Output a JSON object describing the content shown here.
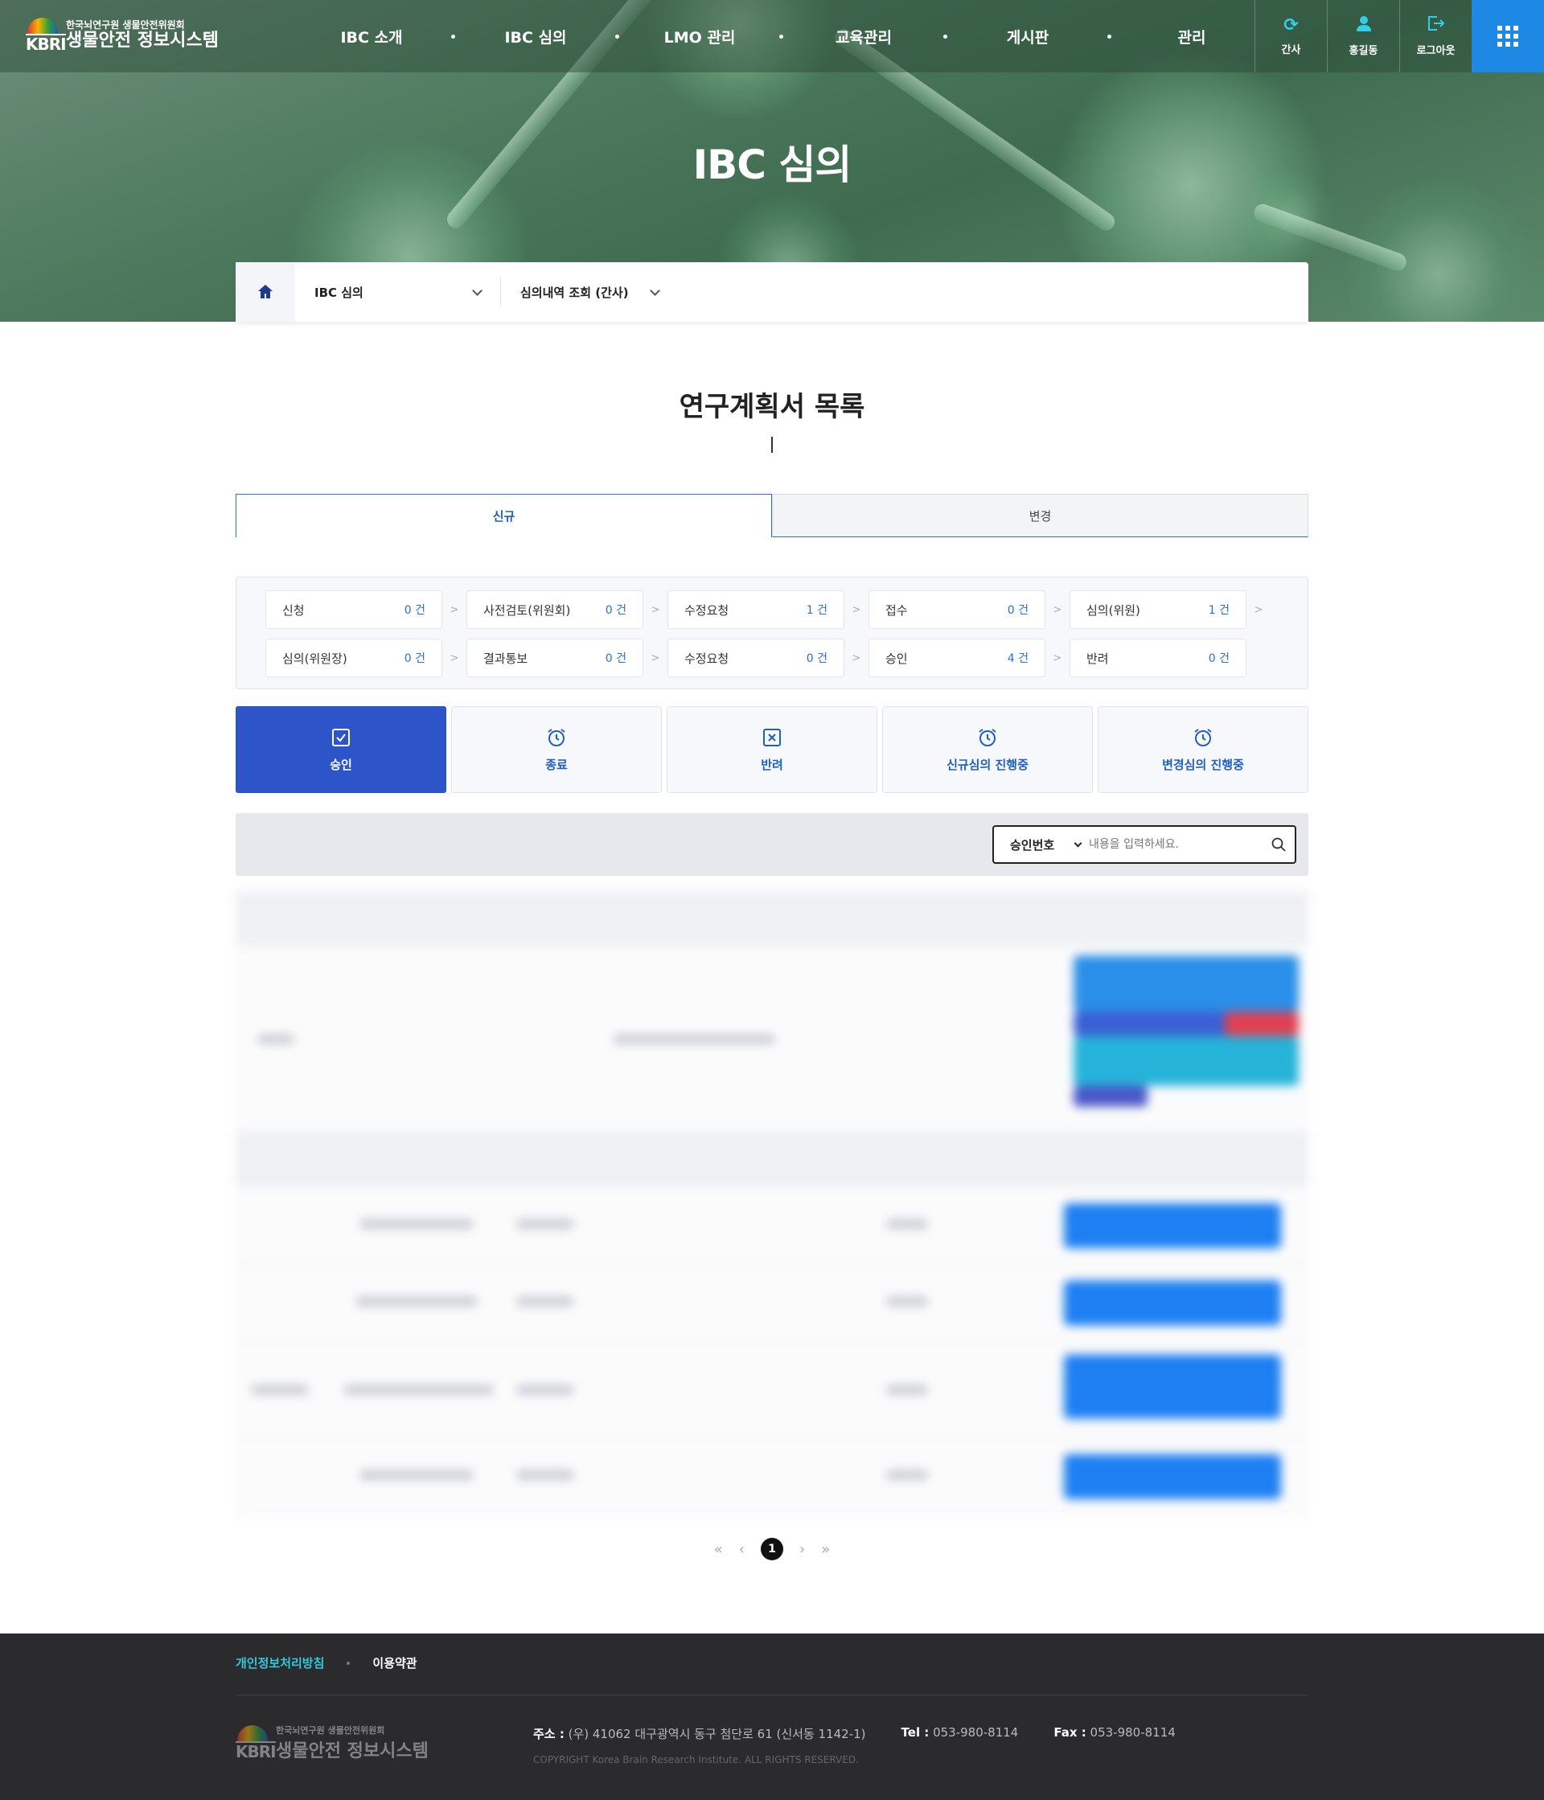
{
  "header": {
    "logo_sub": "한국뇌연구원 생물안전위원회",
    "logo_main": "생물안전 정보시스템",
    "logo_mark": "KBRI",
    "nav": [
      "IBC 소개",
      "IBC 심의",
      "LMO 관리",
      "교육관리",
      "게시판",
      "관리"
    ],
    "util": {
      "role_label": "간사",
      "role_icon": "refresh-icon",
      "user_label": "홍길동",
      "user_icon": "person-icon",
      "logout_label": "로그아웃",
      "logout_icon": "logout-icon",
      "allmenu_icon": "grid-menu-icon"
    }
  },
  "hero": {
    "title": "IBC 심의"
  },
  "location": {
    "home_icon": "home-icon",
    "depth1": "IBC 심의",
    "depth2": "심의내역 조회 (간사)"
  },
  "page": {
    "title": "연구계획서 목록"
  },
  "tabs": [
    {
      "label": "신규",
      "active": true
    },
    {
      "label": "변경",
      "active": false
    }
  ],
  "status_rows": [
    [
      {
        "label": "신청",
        "count": "0 건"
      },
      {
        "label": "사전검토(위원회)",
        "count": "0 건"
      },
      {
        "label": "수정요청",
        "count": "1 건"
      },
      {
        "label": "접수",
        "count": "0 건"
      },
      {
        "label": "심의(위원)",
        "count": "1 건"
      }
    ],
    [
      {
        "label": "심의(위원장)",
        "count": "0 건"
      },
      {
        "label": "결과통보",
        "count": "0 건"
      },
      {
        "label": "수정요청",
        "count": "0 건"
      },
      {
        "label": "승인",
        "count": "4 건"
      },
      {
        "label": "반려",
        "count": "0 건"
      }
    ]
  ],
  "filters": [
    {
      "label": "승인",
      "icon": "checkbox-icon",
      "active": true
    },
    {
      "label": "종료",
      "icon": "alarm-clock-icon",
      "active": false
    },
    {
      "label": "반려",
      "icon": "x-box-icon",
      "active": false
    },
    {
      "label": "신규심의 진행중",
      "icon": "alarm-clock-icon",
      "active": false
    },
    {
      "label": "변경심의 진행중",
      "icon": "alarm-clock-icon",
      "active": false
    }
  ],
  "search": {
    "category": "승인번호",
    "placeholder": "내용을 입력하세요.",
    "icon": "search-icon"
  },
  "pagination": {
    "current": "1",
    "first": "«",
    "prev": "‹",
    "next": "›",
    "last": "»"
  },
  "footer": {
    "privacy": "개인정보처리방침",
    "terms": "이용약관",
    "logo_sub": "한국뇌연구원 생물안전위원회",
    "logo_main": "생물안전 정보시스템",
    "address_label": "주소 :",
    "address": "(우) 41062 대구광역시 동구 첨단로 61 (신서동 1142-1)",
    "tel_label": "Tel :",
    "tel": "053-980-8114",
    "fax_label": "Fax :",
    "fax": "053-980-8114",
    "copyright": "COPYRIGHT Korea Brain Research Institute. ALL RIGHTS RESERVED."
  },
  "colors": {
    "primary": "#2e54c9",
    "accent_blue": "#1e88e5",
    "link_cyan": "#2fc9e0",
    "footer_bg": "#2b2a2c"
  }
}
